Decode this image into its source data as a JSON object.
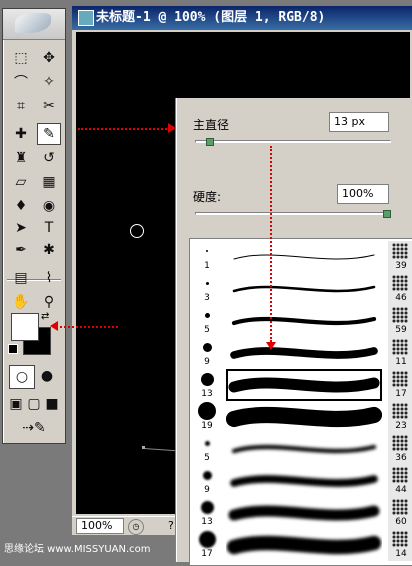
{
  "document": {
    "title": "未标题-1 @ 100% (图层 1, RGB/8)",
    "zoom": "100%",
    "status_char": "?"
  },
  "toolbox": {
    "tools": [
      {
        "name": "marquee-tool-icon",
        "glyph": "⬚"
      },
      {
        "name": "move-tool-icon",
        "glyph": "✥"
      },
      {
        "name": "lasso-tool-icon",
        "glyph": "⌒"
      },
      {
        "name": "magic-wand-tool-icon",
        "glyph": "✧"
      },
      {
        "name": "crop-tool-icon",
        "glyph": "⌗"
      },
      {
        "name": "slice-tool-icon",
        "glyph": "✂"
      },
      {
        "name": "healing-brush-tool-icon",
        "glyph": "✚"
      },
      {
        "name": "brush-tool-icon",
        "glyph": "✎"
      },
      {
        "name": "clone-stamp-tool-icon",
        "glyph": "♜"
      },
      {
        "name": "history-brush-tool-icon",
        "glyph": "↺"
      },
      {
        "name": "eraser-tool-icon",
        "glyph": "▱"
      },
      {
        "name": "gradient-tool-icon",
        "glyph": "▦"
      },
      {
        "name": "blur-tool-icon",
        "glyph": "♦"
      },
      {
        "name": "dodge-tool-icon",
        "glyph": "◉"
      },
      {
        "name": "path-selection-tool-icon",
        "glyph": "➤"
      },
      {
        "name": "type-tool-icon",
        "glyph": "T"
      },
      {
        "name": "pen-tool-icon",
        "glyph": "✒"
      },
      {
        "name": "shape-tool-icon",
        "glyph": "✱"
      },
      {
        "name": "notes-tool-icon",
        "glyph": "▤"
      },
      {
        "name": "eyedropper-tool-icon",
        "glyph": "⌇"
      },
      {
        "name": "hand-tool-icon",
        "glyph": "✋"
      },
      {
        "name": "zoom-tool-icon",
        "glyph": "⚲"
      }
    ],
    "colors": {
      "foreground": "#ffffff",
      "background": "#000000"
    }
  },
  "brush_panel": {
    "master_diameter_label": "主直径",
    "master_diameter_value": "13 px",
    "master_diameter_level": 0.06,
    "hardness_label": "硬度:",
    "hardness_value": "100%",
    "hardness_level": 1.0,
    "brushes": [
      {
        "size": "1",
        "side": "39",
        "selected": false
      },
      {
        "size": "3",
        "side": "46",
        "selected": false
      },
      {
        "size": "5",
        "side": "59",
        "selected": false
      },
      {
        "size": "9",
        "side": "11",
        "selected": false
      },
      {
        "size": "13",
        "side": "17",
        "selected": true
      },
      {
        "size": "19",
        "side": "23",
        "selected": false
      },
      {
        "size": "5",
        "side": "36",
        "selected": false
      },
      {
        "size": "9",
        "side": "44",
        "selected": false
      },
      {
        "size": "13",
        "side": "60",
        "selected": false
      },
      {
        "size": "17",
        "side": "14",
        "selected": false
      }
    ]
  },
  "watermark": "思缘论坛 www.MISSYUAN.com",
  "colors": {
    "accent": "#dd0000",
    "panel": "#d4d0c8",
    "titlebar": "#0a246a"
  }
}
